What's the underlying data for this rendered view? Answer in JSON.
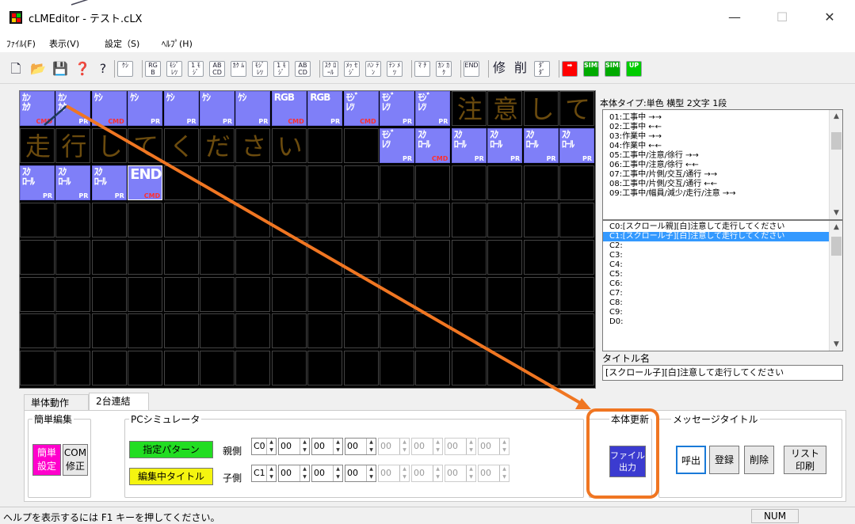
{
  "window": {
    "title": "cLMEditor - テスト.cLX",
    "min": "—",
    "max": "☐",
    "close": "✕"
  },
  "menu": [
    "ﾌｧｲﾙ(F)",
    "表示(V)",
    "設定（S)",
    "ﾍﾙﾌﾟ(H)"
  ],
  "toolbar": {
    "new": "🗋",
    "open": "📂",
    "save": "💾",
    "whatsthis": "❓",
    "help": "?",
    "groups": [
      [
        "ｹｼ"
      ],
      [
        "RG B",
        "ﾓｼﾞ ﾚﾂ",
        "1 ﾓｼﾞ",
        "AB CD",
        "ｶｸ ﾑ",
        "ﾓｼﾞ ﾚﾂ",
        "1 ﾓｼﾞ",
        "AB CD"
      ],
      [
        "ｽｸ ﾛｰﾙ",
        "ﾒｯ ｾｼﾞ",
        "ﾊﾝ ﾃﾝ",
        "ﾃﾝ ﾒﾂ"
      ],
      [
        "ﾏ ﾁ",
        "ｶﾝ ｶｸ"
      ],
      [
        "END"
      ],
      [
        "修",
        "削",
        "ﾀﾞ ﾀﾞ"
      ],
      [
        "➡",
        "SIMI",
        "SIMP",
        "UP"
      ]
    ]
  },
  "grid": {
    "cells": [
      {
        "r": 0,
        "c": 0,
        "kind": "blue",
        "tl": "ｶﾝ\nｶｸ",
        "sub": "CMD",
        "cmd": true
      },
      {
        "r": 0,
        "c": 1,
        "kind": "blue",
        "tl": "ｶﾝ\nｶｸ",
        "sub": "PR",
        "cmd": false
      },
      {
        "r": 0,
        "c": 2,
        "kind": "blue",
        "tl": "ｹｼ",
        "sub": "CMD",
        "cmd": true
      },
      {
        "r": 0,
        "c": 3,
        "kind": "blue",
        "tl": "ｹｼ",
        "sub": "PR",
        "cmd": false
      },
      {
        "r": 0,
        "c": 4,
        "kind": "blue",
        "tl": "ｹｼ",
        "sub": "PR",
        "cmd": false
      },
      {
        "r": 0,
        "c": 5,
        "kind": "blue",
        "tl": "ｹｼ",
        "sub": "PR",
        "cmd": false
      },
      {
        "r": 0,
        "c": 6,
        "kind": "blue",
        "tl": "ｹｼ",
        "sub": "PR",
        "cmd": false
      },
      {
        "r": 0,
        "c": 7,
        "kind": "blue",
        "tl": "RGB",
        "sub": "CMD",
        "cmd": true
      },
      {
        "r": 0,
        "c": 8,
        "kind": "blue",
        "tl": "RGB",
        "sub": "PR",
        "cmd": false
      },
      {
        "r": 0,
        "c": 9,
        "kind": "blue",
        "tl": "ﾓｼﾞ\nﾚﾂ",
        "sub": "CMD",
        "cmd": true
      },
      {
        "r": 0,
        "c": 10,
        "kind": "blue",
        "tl": "ﾓｼﾞ\nﾚﾂ",
        "sub": "PR",
        "cmd": false
      },
      {
        "r": 0,
        "c": 11,
        "kind": "blue",
        "tl": "ﾓｼﾞ\nﾚﾂ",
        "sub": "PR",
        "cmd": false
      },
      {
        "r": 0,
        "c": 12,
        "kind": "char",
        "ch": "注"
      },
      {
        "r": 0,
        "c": 13,
        "kind": "char",
        "ch": "意"
      },
      {
        "r": 0,
        "c": 14,
        "kind": "char",
        "ch": "し"
      },
      {
        "r": 0,
        "c": 15,
        "kind": "char",
        "ch": "て"
      },
      {
        "r": 1,
        "c": 0,
        "kind": "char",
        "ch": "走"
      },
      {
        "r": 1,
        "c": 1,
        "kind": "char",
        "ch": "行"
      },
      {
        "r": 1,
        "c": 2,
        "kind": "char",
        "ch": "し"
      },
      {
        "r": 1,
        "c": 3,
        "kind": "char",
        "ch": "て"
      },
      {
        "r": 1,
        "c": 4,
        "kind": "char",
        "ch": "く"
      },
      {
        "r": 1,
        "c": 5,
        "kind": "char",
        "ch": "だ"
      },
      {
        "r": 1,
        "c": 6,
        "kind": "char",
        "ch": "さ"
      },
      {
        "r": 1,
        "c": 7,
        "kind": "char",
        "ch": "い"
      },
      {
        "r": 1,
        "c": 10,
        "kind": "blue",
        "tl": "ﾓｼﾞ\nﾚﾂ",
        "sub": "PR",
        "cmd": false
      },
      {
        "r": 1,
        "c": 11,
        "kind": "blue",
        "tl": "ｽｸ\nﾛｰﾙ",
        "sub": "CMD",
        "cmd": true
      },
      {
        "r": 1,
        "c": 12,
        "kind": "blue",
        "tl": "ｽｸ\nﾛｰﾙ",
        "sub": "PR",
        "cmd": false
      },
      {
        "r": 1,
        "c": 13,
        "kind": "blue",
        "tl": "ｽｸ\nﾛｰﾙ",
        "sub": "PR",
        "cmd": false
      },
      {
        "r": 1,
        "c": 14,
        "kind": "blue",
        "tl": "ｽｸ\nﾛｰﾙ",
        "sub": "PR",
        "cmd": false
      },
      {
        "r": 1,
        "c": 15,
        "kind": "blue",
        "tl": "ｽｸ\nﾛｰﾙ",
        "sub": "PR",
        "cmd": false
      },
      {
        "r": 2,
        "c": 0,
        "kind": "blue",
        "tl": "ｽｸ\nﾛｰﾙ",
        "sub": "PR",
        "cmd": false
      },
      {
        "r": 2,
        "c": 1,
        "kind": "blue",
        "tl": "ｽｸ\nﾛｰﾙ",
        "sub": "PR",
        "cmd": false
      },
      {
        "r": 2,
        "c": 2,
        "kind": "blue",
        "tl": "ｽｸ\nﾛｰﾙ",
        "sub": "PR",
        "cmd": false
      },
      {
        "r": 2,
        "c": 3,
        "kind": "blue-sel",
        "tl": "END",
        "sub": "CMD",
        "cmd": true
      }
    ]
  },
  "right": {
    "type_label": "本体タイプ:単色 横型 2文字 1段",
    "patterns": [
      "01:工事中 →→",
      "02:工事中 ←←",
      "03:作業中 →→",
      "04:作業中 ←←",
      "05:工事中/注意/徐行 →→",
      "06:工事中/注意/徐行 ←←",
      "07:工事中/片側/交互/通行 →→",
      "08:工事中/片側/交互/通行 ←←",
      "09:工事中/幅員/減少/走行/注意 →→"
    ],
    "messages": [
      "C0:[スクロール親][白]注意して走行してください",
      "C1:[スクロール子][白]注意して走行してください",
      "C2:",
      "C3:",
      "C4:",
      "C5:",
      "C6:",
      "C7:",
      "C8:",
      "C9:",
      "D0:"
    ],
    "selected_message": 1,
    "title_label": "タイトル名",
    "title_value": "[スクロール子][白]注意して走行してください"
  },
  "tabs": [
    "単体動作",
    "2台連結"
  ],
  "active_tab": 1,
  "panel": {
    "simple_edit": "簡単編集",
    "simple_btn": "簡単\n設定",
    "com_btn": "COM\n修正",
    "pc_sim": "PCシミュレータ",
    "pattern_btn": "指定パターン",
    "title_btn": "編集中タイトル",
    "parent_label": "親側",
    "child_label": "子側",
    "parent_values": [
      "C0",
      "00",
      "00",
      "00",
      "00",
      "00",
      "00",
      "00"
    ],
    "child_values": [
      "C1",
      "00",
      "00",
      "00",
      "00",
      "00",
      "00",
      "00"
    ],
    "update_group": "本体更新",
    "file_btn": "ファイル\n出力",
    "msgtitle_group": "メッセージタイトル",
    "call_btn": "呼出",
    "reg_btn": "登録",
    "del_btn": "削除",
    "list_btn": "リスト\n印刷"
  },
  "status": {
    "message": "ヘルプを表示するには F1 キーを押してください。",
    "num": "NUM"
  },
  "colors": {
    "cell_blue": "#7f7ff8",
    "accent_orange": "#f07622",
    "magenta": "#ff00cc",
    "green": "#22dd22",
    "yellow": "#f5f510",
    "select_blue": "#3399ff"
  }
}
